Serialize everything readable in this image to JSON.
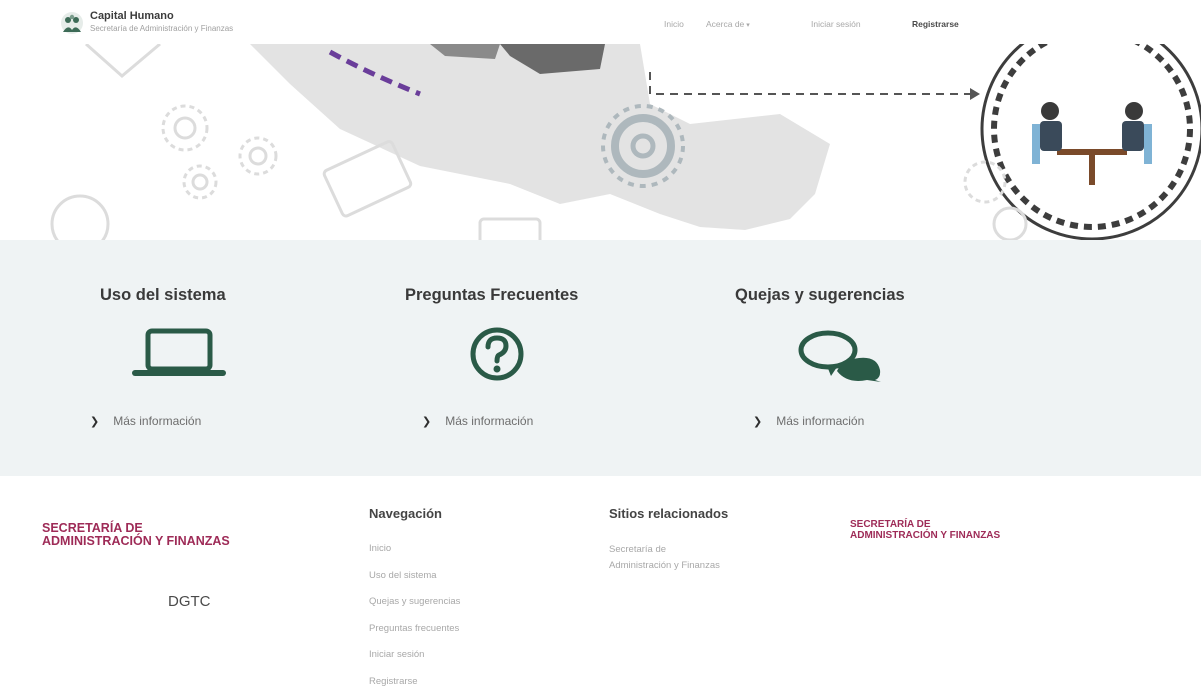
{
  "brand": {
    "title": "Capital Humano",
    "subtitle": "Secretaría de Administración y Finanzas"
  },
  "nav": {
    "items": [
      {
        "label": "Inicio"
      },
      {
        "label": "Acerca de"
      },
      {
        "label": "Iniciar sesión"
      },
      {
        "label": "Registrarse"
      }
    ],
    "caret": "▾"
  },
  "services": [
    {
      "title": "Uso del sistema",
      "icon": "laptop-icon",
      "link": "Más información"
    },
    {
      "title": "Preguntas Frecuentes",
      "icon": "question-circle-icon",
      "link": "Más información"
    },
    {
      "title": "Quejas y sugerencias",
      "icon": "chat-bubbles-icon",
      "link": "Más información"
    }
  ],
  "chevron": "❯",
  "footer": {
    "org_name_line1": "SECRETARÍA DE",
    "org_name_line2": "ADMINISTRACIÓN Y FINANZAS",
    "dgtc": "DGTC",
    "navigation": {
      "heading": "Navegación",
      "items": [
        "Inicio",
        "Uso del sistema",
        "Quejas y sugerencias",
        "Preguntas frecuentes",
        "Iniciar sesión",
        "Registrarse"
      ]
    },
    "related": {
      "heading": "Sitios relacionados",
      "link_line1": "Secretaría de",
      "link_line2": "Administración y Finanzas"
    }
  },
  "colors": {
    "accent_green": "#2a5a47",
    "brand_magenta": "#9e2b57",
    "band_background": "#eff3f4"
  }
}
